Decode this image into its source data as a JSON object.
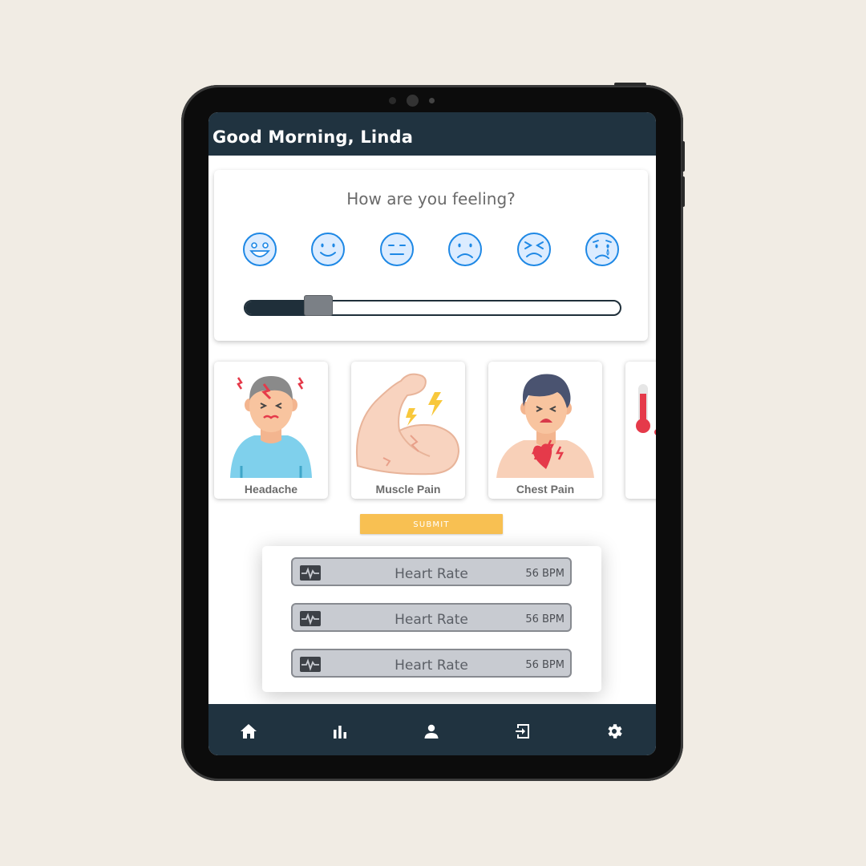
{
  "header": {
    "greeting": "Good Morning, Linda"
  },
  "mood": {
    "title": "How are you feeling?",
    "faces": [
      "very-happy-face-icon",
      "happy-face-icon",
      "neutral-face-icon",
      "sad-face-icon",
      "distressed-face-icon",
      "crying-face-icon"
    ],
    "slider_value": 0.2,
    "accent_color": "#1e88e5"
  },
  "symptoms": [
    {
      "label": "Headache",
      "icon": "headache-person-icon"
    },
    {
      "label": "Muscle Pain",
      "icon": "flexed-arm-pain-icon"
    },
    {
      "label": "Chest Pain",
      "icon": "chest-pain-person-icon"
    },
    {
      "label": "",
      "icon": "thermometer-icon"
    }
  ],
  "submit": {
    "label": "SUBMIT",
    "color": "#f8c052"
  },
  "vitals": [
    {
      "label": "Heart Rate",
      "value": "56 BPM",
      "icon": "heart-monitor-icon"
    },
    {
      "label": "Heart Rate",
      "value": "56 BPM",
      "icon": "heart-monitor-icon"
    },
    {
      "label": "Heart Rate",
      "value": "56 BPM",
      "icon": "heart-monitor-icon"
    }
  ],
  "nav": {
    "items": [
      "home-icon",
      "bar-chart-icon",
      "person-icon",
      "logout-icon",
      "settings-icon"
    ],
    "background": "#203340"
  }
}
